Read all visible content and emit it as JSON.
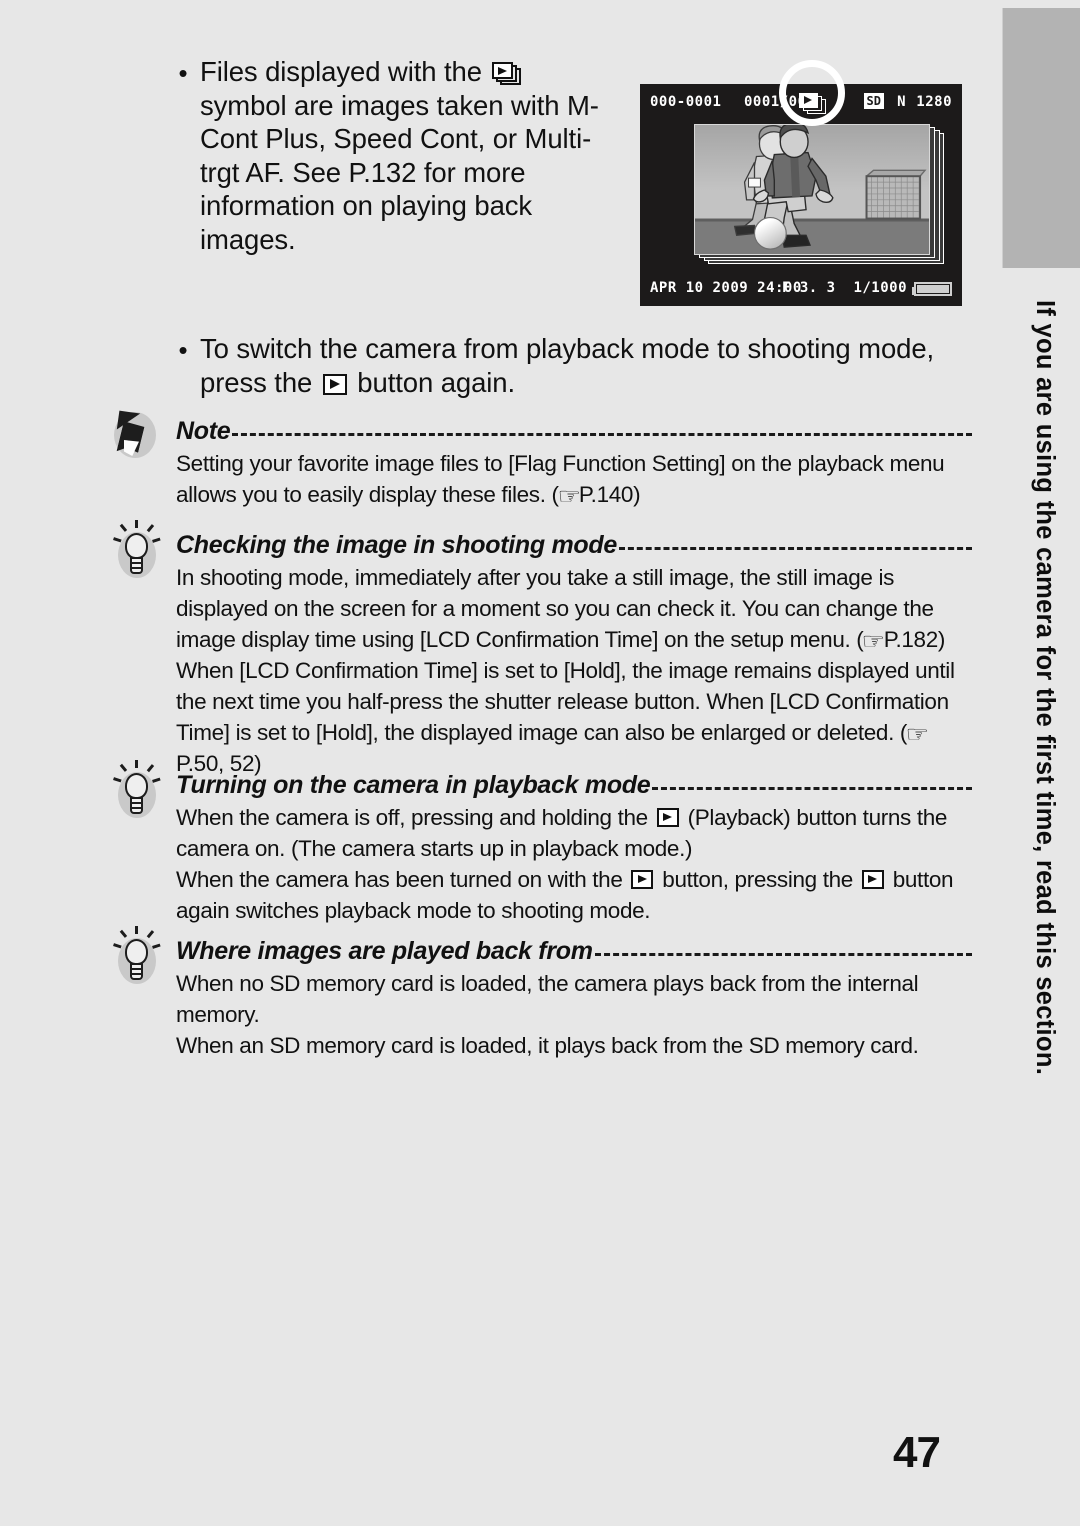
{
  "page": {
    "number": "47",
    "background_color": "#e7e7e7",
    "side_tab": {
      "text": "If you are using the camera for the first time, read this section.",
      "marker_color": "#b3b3b3"
    }
  },
  "bullets": [
    {
      "marker": "•",
      "text_before_icon": "Files displayed with the ",
      "icon": "stacked-play-icon",
      "text_after_icon": " symbol are images taken with M-Cont Plus, Speed Cont, or Multi-trgt AF. See P.132 for more information on playing back images."
    },
    {
      "marker": "•",
      "text_before_icon": "To switch the camera from playback mode to shooting mode, press the ",
      "icon": "play-button-icon",
      "text_after_icon": " button again."
    }
  ],
  "lcd": {
    "file_number": "000-0001",
    "frame_number": "0001/000",
    "mcont_icon": "stacked-play-icon",
    "card_badge": "SD",
    "quality": "N",
    "pixels": "1280",
    "date": "APR 10 2009 24:00",
    "aperture": "F 3. 3",
    "shutter_speed": "1/1000",
    "battery": "battery-full-icon",
    "photo_subject": "two soccer players with ball and goal"
  },
  "blocks": [
    {
      "icon": "note-icon",
      "title": "Note",
      "paragraphs": [
        "Setting your favorite image files to [Flag Function Setting] on the playback menu allows you to easily display these files. (☞P.140)"
      ]
    },
    {
      "icon": "lightbulb-icon",
      "title": "Checking the image in shooting mode",
      "paragraphs": [
        "In shooting mode, immediately after you take a still image, the still image is displayed on the screen for a moment so you can check it. You can change the image display time using [LCD Confirmation Time] on the setup menu. (☞P.182)",
        "When [LCD Confirmation Time] is set to [Hold], the image remains displayed until the next time you half-press the shutter release button. When [LCD Confirmation Time] is set to [Hold], the displayed image can also be enlarged or deleted. (☞P.50, 52)"
      ]
    },
    {
      "icon": "lightbulb-icon",
      "title": "Turning on the camera in playback mode",
      "paragraphs": [
        "When the camera is off, pressing and holding the ▶ (Playback) button turns the camera on. (The camera starts up in playback mode.)",
        "When the camera has been turned on with the ▶ button, pressing the ▶ button again switches playback mode to shooting mode."
      ]
    },
    {
      "icon": "lightbulb-icon",
      "title": "Where images are played back from",
      "paragraphs": [
        "When no SD memory card is loaded, the camera plays back from the internal memory.",
        "When an SD memory card is loaded, it plays back from the SD memory card."
      ]
    }
  ],
  "block_text": {
    "note_p1": "Setting your favorite image files to [Flag Function Setting] on the playback menu allows you to easily display these files. (",
    "note_p1_end": "P.140)",
    "check_p1_a": "In shooting mode, immediately after you take a still image, the still image is displayed on the screen for a moment so you can check it. You can change the image display time using [LCD Confirmation Time] on the setup menu. (",
    "check_p1_b": "P.182)",
    "check_p2_a": "When [LCD Confirmation Time] is set to [Hold], the image remains displayed until the next time you half-press the shutter release button. When [LCD Confirmation Time] is set to [Hold], the displayed image can also be enlarged or deleted. (",
    "check_p2_b": "P.50, 52)",
    "turn_p1_a": "When the camera is off, pressing and holding the ",
    "turn_p1_b": " (Playback) button turns the camera on. (The camera starts up in playback mode.)",
    "turn_p2_a": "When the camera has been turned on with the ",
    "turn_p2_b": " button, pressing the ",
    "turn_p2_c": " button again switches playback mode to shooting mode.",
    "where_p1": "When no SD memory card is loaded, the camera plays back from the internal memory.",
    "where_p2": "When an SD memory card is loaded, it plays back from the SD memory card."
  }
}
